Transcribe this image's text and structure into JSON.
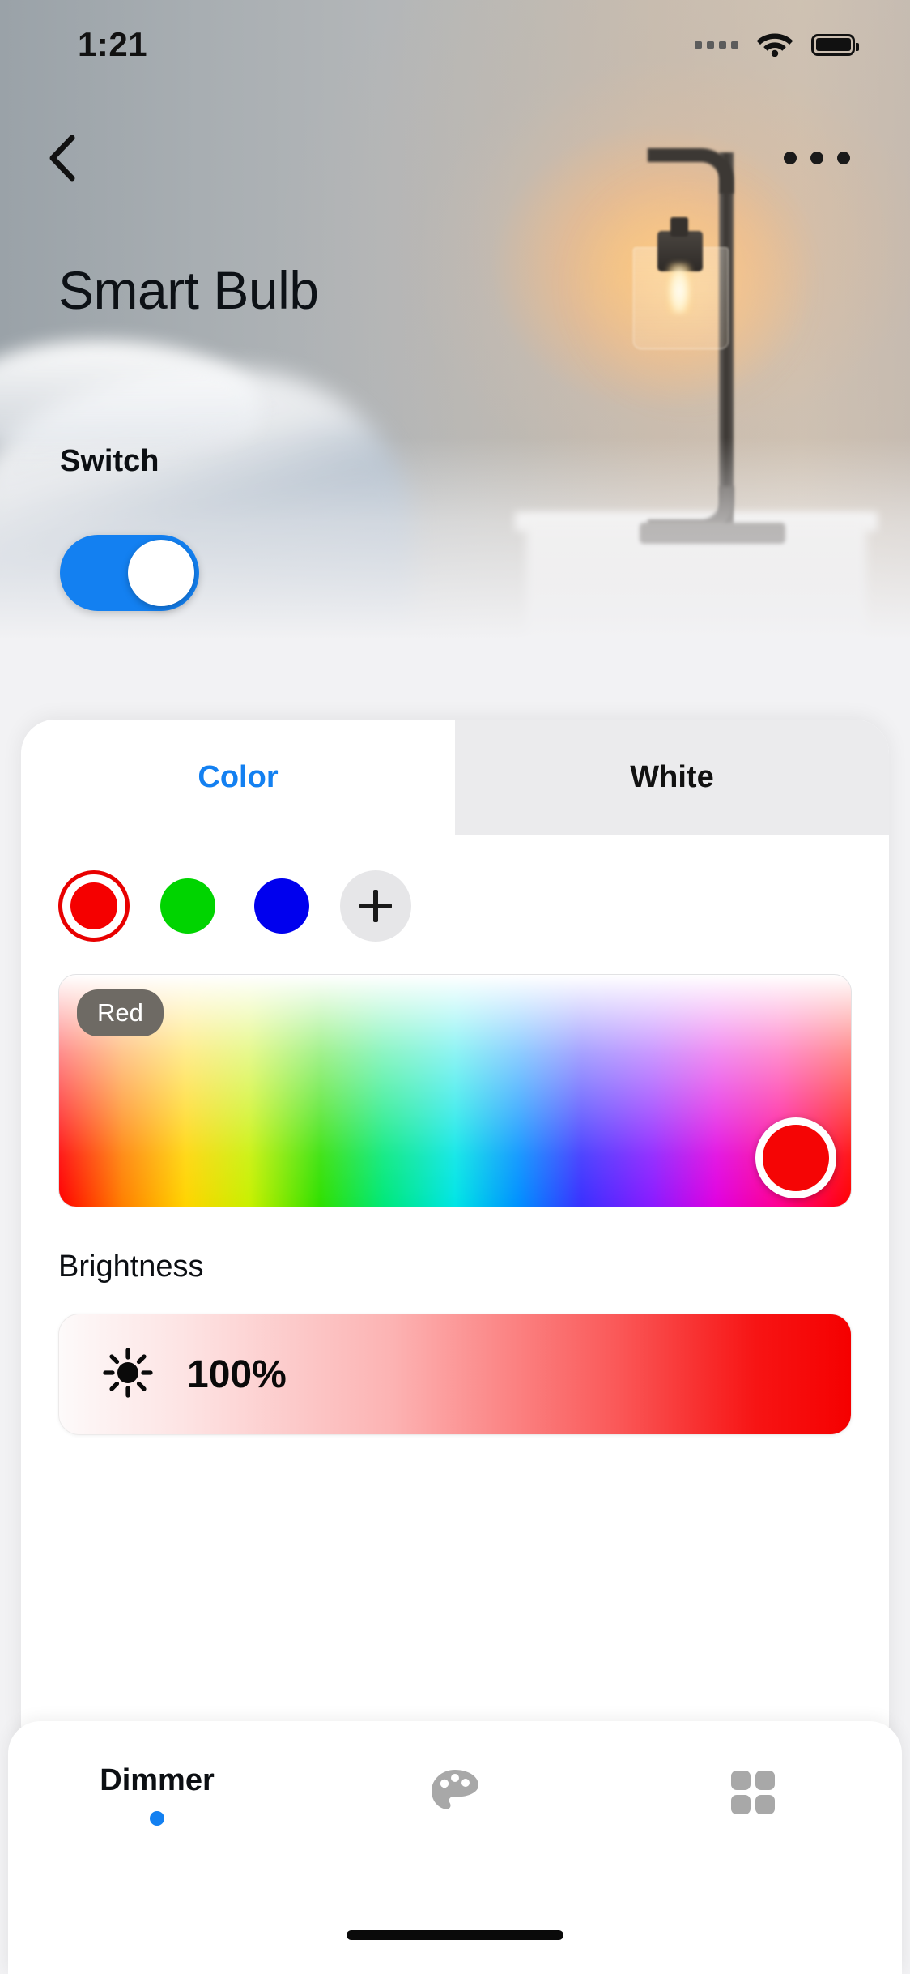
{
  "status_bar": {
    "time": "1:21",
    "signal_icon": "signal-dots-icon",
    "wifi_icon": "wifi-icon",
    "battery_icon": "battery-full-icon"
  },
  "nav": {
    "back_icon": "chevron-left-icon",
    "more_icon": "more-horizontal-icon"
  },
  "device": {
    "title": "Smart Bulb"
  },
  "switch_section": {
    "label": "Switch",
    "state": "on",
    "accent_color": "#1380f1"
  },
  "tabs": [
    {
      "label": "Color",
      "active": true
    },
    {
      "label": "White",
      "active": false
    }
  ],
  "color_panel": {
    "swatches": [
      {
        "name": "red-swatch",
        "color": "#f50000",
        "selected": true
      },
      {
        "name": "green-swatch",
        "color": "#00d400",
        "selected": false
      },
      {
        "name": "blue-swatch",
        "color": "#0000ee",
        "selected": false
      }
    ],
    "add_button": {
      "icon": "plus-icon",
      "label": ""
    },
    "picker": {
      "selected_color_name": "Red",
      "handle_color": "#f50505",
      "handle_position": {
        "x_pct": 92,
        "y_pct": 88
      }
    }
  },
  "brightness": {
    "label": "Brightness",
    "icon": "sun-icon",
    "value": "100%",
    "percent": 100,
    "track_end_color": "#f50000"
  },
  "bottom_nav": [
    {
      "label": "Dimmer",
      "icon": "",
      "active": true
    },
    {
      "label": "",
      "icon": "palette-icon",
      "active": false
    },
    {
      "label": "",
      "icon": "grid-icon",
      "active": false
    }
  ],
  "home_indicator": "home-indicator"
}
